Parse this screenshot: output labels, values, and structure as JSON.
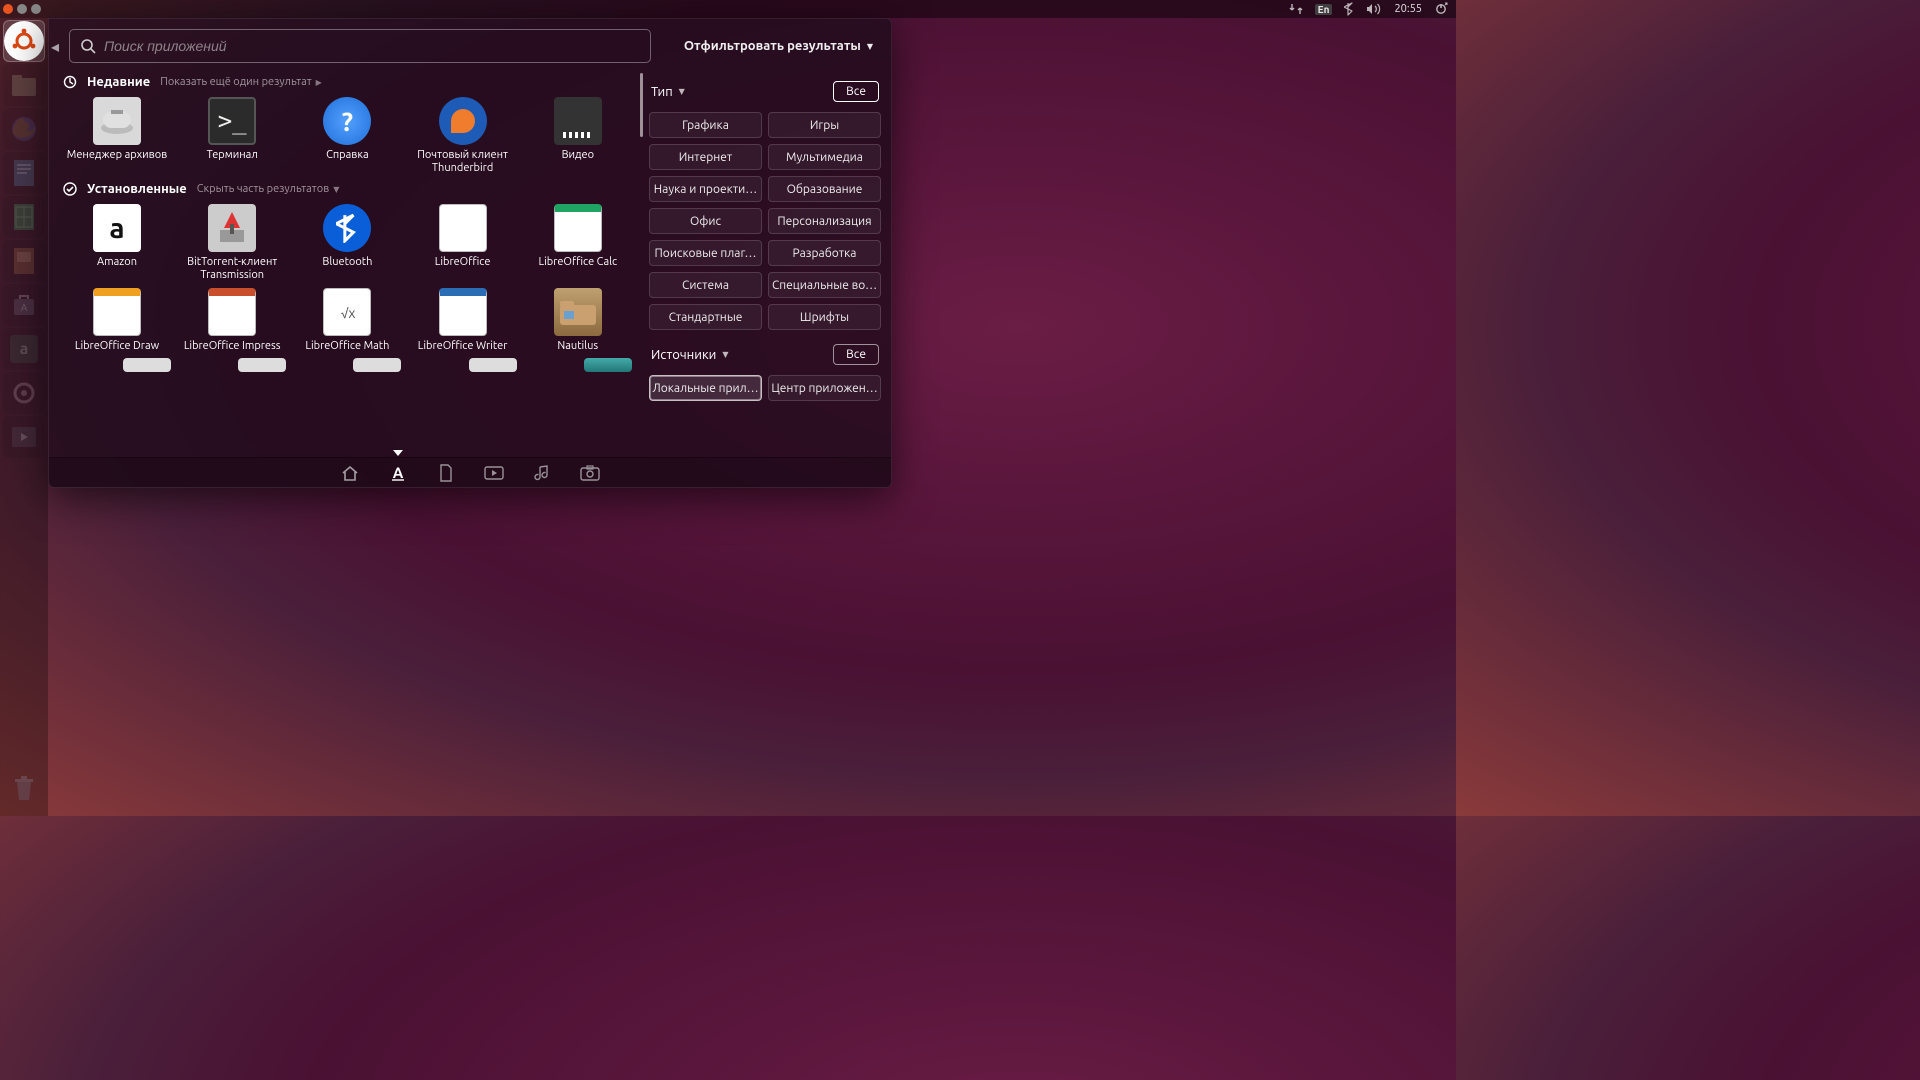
{
  "panel": {
    "language": "En",
    "clock": "20:55"
  },
  "launcher": {
    "items": [
      {
        "name": "ubuntu-dash",
        "active": true
      },
      {
        "name": "files",
        "dim": true
      },
      {
        "name": "firefox",
        "dim": true
      },
      {
        "name": "libreoffice-writer",
        "dim": true
      },
      {
        "name": "libreoffice-calc",
        "dim": true
      },
      {
        "name": "libreoffice-impress",
        "dim": true
      },
      {
        "name": "software-center",
        "dim": true
      },
      {
        "name": "amazon",
        "dim": true
      },
      {
        "name": "system-settings",
        "dim": true
      },
      {
        "name": "videos",
        "dim": true
      }
    ]
  },
  "dash": {
    "search_placeholder": "Поиск приложений",
    "filter_toggle": "Отфильтровать результаты",
    "sections": {
      "recent": {
        "title": "Недавние",
        "hint": "Показать ещё один результат",
        "apps": [
          {
            "label": "Менеджер архивов",
            "ico": "archive"
          },
          {
            "label": "Терминал",
            "ico": "terminal"
          },
          {
            "label": "Справка",
            "ico": "help"
          },
          {
            "label": "Почтовый клиент Thunderbird",
            "ico": "thunderbird"
          },
          {
            "label": "Видео",
            "ico": "video"
          }
        ]
      },
      "installed": {
        "title": "Установленные",
        "hint": "Скрыть часть результатов",
        "apps": [
          {
            "label": "Amazon",
            "ico": "amazon"
          },
          {
            "label": "BitTorrent-клиент Transmission",
            "ico": "transmission"
          },
          {
            "label": "Bluetooth",
            "ico": "bluetooth"
          },
          {
            "label": "LibreOffice",
            "ico": "lo"
          },
          {
            "label": "LibreOffice Calc",
            "ico": "lo calc"
          },
          {
            "label": "LibreOffice Draw",
            "ico": "lo draw"
          },
          {
            "label": "LibreOffice Impress",
            "ico": "lo impress"
          },
          {
            "label": "LibreOffice Math",
            "ico": "lo math"
          },
          {
            "label": "LibreOffice Writer",
            "ico": "lo writer"
          },
          {
            "label": "Nautilus",
            "ico": "nautilus"
          }
        ]
      }
    },
    "filters": {
      "type": {
        "label": "Тип",
        "all": "Все",
        "options": [
          "Графика",
          "Игры",
          "Интернет",
          "Мультимедиа",
          "Наука и проекти…",
          "Образование",
          "Офис",
          "Персонализация",
          "Поисковые плаг…",
          "Разработка",
          "Система",
          "Специальные во…",
          "Стандартные",
          "Шрифты"
        ]
      },
      "sources": {
        "label": "Источники",
        "all": "Все",
        "options": [
          "Локальные прил…",
          "Центр приложен…"
        ],
        "active_idx": 0
      }
    },
    "lenses": [
      "home",
      "applications",
      "files",
      "videos",
      "music",
      "photos"
    ],
    "active_lens": 1
  }
}
